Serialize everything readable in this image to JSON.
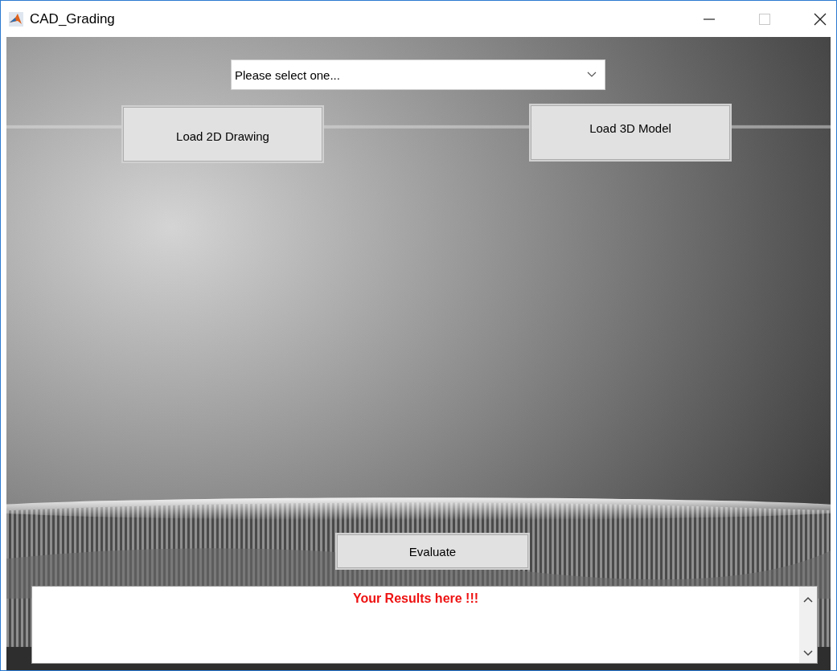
{
  "window": {
    "title": "CAD_Grading",
    "maximize_enabled": false
  },
  "dropdown": {
    "value": "Please select one..."
  },
  "buttons": [
    {
      "label": "Load 2D Drawing",
      "kind": "load2d"
    },
    {
      "label": "Load 3D Model",
      "kind": "load3d"
    },
    {
      "label": "Evaluate",
      "kind": "evaluate"
    }
  ],
  "results": {
    "text": "Your Results here !!!"
  }
}
